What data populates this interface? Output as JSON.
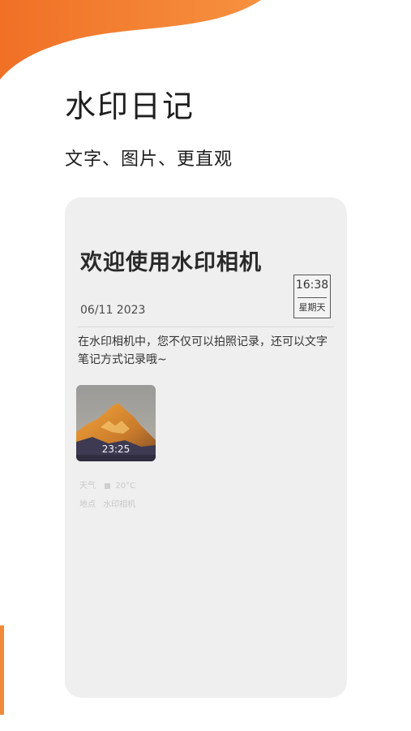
{
  "header": {
    "title": "水印日记",
    "subtitle": "文字、图片、更直观"
  },
  "card": {
    "title": "欢迎使用水印相机",
    "date": "06/11 2023",
    "time": "16:38",
    "weekday": "星期天",
    "body": "在水印相机中，您不仅可以拍照记录，还可以文字笔记方式记录哦~",
    "photo": {
      "stamp_time": "23:25"
    },
    "meta": {
      "weather_label": "天气",
      "weather_value": "20°C",
      "location_label": "地点",
      "location_value": "水印相机"
    }
  },
  "colors": {
    "accent": "#F07A2A",
    "card_bg": "#EFEFEF"
  }
}
